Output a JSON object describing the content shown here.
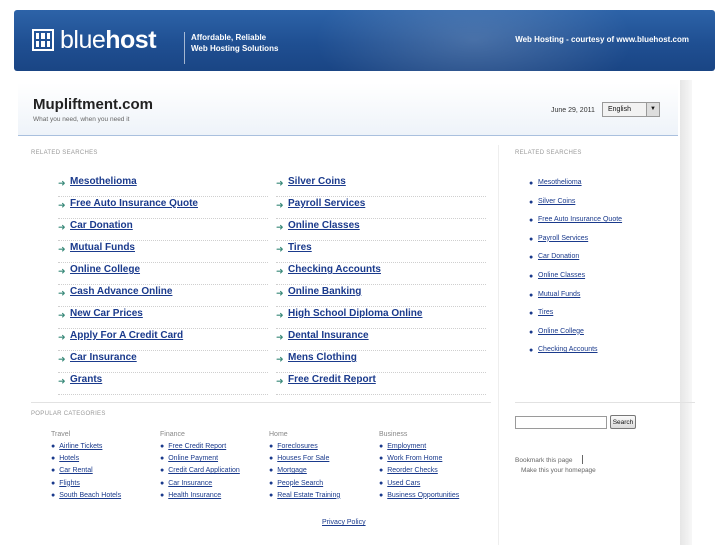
{
  "banner": {
    "logo_light": "blue",
    "logo_bold": "host",
    "tagline_line1": "Affordable, Reliable",
    "tagline_line2": "Web Hosting Solutions",
    "courtesy": "Web Hosting - courtesy of www.bluehost.com"
  },
  "header": {
    "site_title": "Mupliftment.com",
    "site_subtitle": "What you need, when you need it",
    "date": "June 29, 2011",
    "language": "English"
  },
  "related": {
    "label": "RELATED SEARCHES",
    "left_column": [
      "Mesothelioma",
      "Free Auto Insurance Quote",
      "Car Donation",
      "Mutual Funds",
      "Online College",
      "Cash Advance Online",
      "New Car Prices",
      "Apply For A Credit Card",
      "Car Insurance",
      "Grants"
    ],
    "right_column": [
      "Silver Coins",
      "Payroll Services",
      "Online Classes",
      "Tires",
      "Checking Accounts",
      "Online Banking",
      "High School Diploma Online",
      "Dental Insurance",
      "Mens Clothing",
      "Free Credit Report"
    ]
  },
  "sidebar": {
    "label": "RELATED SEARCHES",
    "items": [
      "Mesothelioma",
      "Silver Coins",
      "Free Auto Insurance Quote",
      "Payroll Services",
      "Car Donation",
      "Online Classes",
      "Mutual Funds",
      "Tires",
      "Online College",
      "Checking Accounts"
    ],
    "search_button": "Search",
    "bookmark": "Bookmark this page",
    "homepage": "Make this your homepage"
  },
  "popular": {
    "label": "POPULAR CATEGORIES",
    "categories": [
      {
        "title": "Travel",
        "items": [
          "Airline Tickets",
          "Hotels",
          "Car Rental",
          "Flights",
          "South Beach Hotels"
        ]
      },
      {
        "title": "Finance",
        "items": [
          "Free Credit Report",
          "Online Payment",
          "Credit Card Application",
          "Car Insurance",
          "Health Insurance"
        ]
      },
      {
        "title": "Home",
        "items": [
          "Foreclosures",
          "Houses For Sale",
          "Mortgage",
          "People Search",
          "Real Estate Training"
        ]
      },
      {
        "title": "Business",
        "items": [
          "Employment",
          "Work From Home",
          "Reorder Checks",
          "Used Cars",
          "Business Opportunities"
        ]
      }
    ]
  },
  "footer": {
    "privacy": "Privacy Policy"
  },
  "icons": {
    "arrow": "right-arrow-icon",
    "bullet": "bullet-icon",
    "dropdown": "chevron-down-icon",
    "logo": "bluehost-logo-icon"
  },
  "colors": {
    "banner": "#1f4f92",
    "link": "#1a3a8c",
    "arrow": "#3a8a7a"
  }
}
